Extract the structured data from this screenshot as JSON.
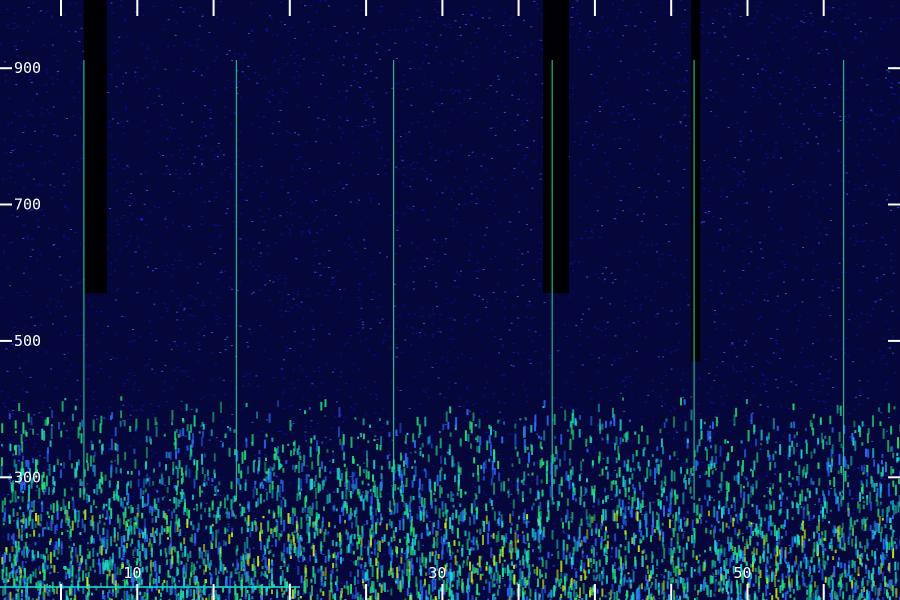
{
  "chart_data": {
    "type": "heatmap",
    "title": "",
    "xlabel": "",
    "ylabel": "",
    "x_range": [
      1,
      60
    ],
    "y_range": [
      120,
      1000
    ],
    "x_tick_labels": [
      "10",
      "30",
      "50"
    ],
    "y_tick_labels": [
      "900",
      "700",
      "500",
      "300"
    ],
    "x_ticks": [
      10,
      30,
      50
    ],
    "x_minor_ticks": [
      5,
      15,
      20,
      25,
      35,
      40,
      45,
      55
    ],
    "y_ticks": [
      900,
      700,
      500,
      300
    ],
    "colormap": [
      "#000000",
      "#000060",
      "#1010c0",
      "#2a6cff",
      "#19d8d0",
      "#22e078",
      "#c8f018"
    ],
    "background_color": "#05063a",
    "bright_lines_x": [
      6.5,
      16.5,
      26.8,
      37.2,
      46.5,
      56.3
    ],
    "dark_columns": [
      {
        "x_from": 6.5,
        "x_to": 8.0,
        "y_from": 570,
        "y_to": 1000
      },
      {
        "x_from": 36.6,
        "x_to": 38.3,
        "y_from": 570,
        "y_to": 1000
      },
      {
        "x_from": 46.3,
        "x_to": 46.9,
        "y_from": 470,
        "y_to": 1000
      }
    ],
    "energy_band_y": [
      120,
      420
    ]
  }
}
